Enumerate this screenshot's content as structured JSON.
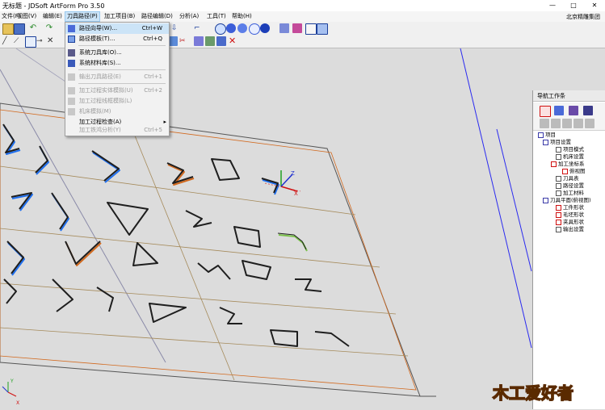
{
  "window": {
    "title": "无标题 - JDSoft ArtForm Pro 3.50",
    "controls": [
      "—",
      "□",
      "✕"
    ]
  },
  "menubar": {
    "items": [
      {
        "label": "文件(F)"
      },
      {
        "label": "视图(V)"
      },
      {
        "label": "编辑(E)"
      },
      {
        "label": "刀具路径(P)"
      },
      {
        "label": "加工项目(B)"
      },
      {
        "label": "路径编辑(D)"
      },
      {
        "label": "分析(A)"
      },
      {
        "label": "工具(T)"
      },
      {
        "label": "帮助(H)"
      }
    ],
    "company": "北京精雕集团"
  },
  "toolpath_menu": {
    "items": [
      {
        "label": "路径向导(W)...",
        "shortcut": "Ctrl+W",
        "enabled": true,
        "icon": "path-wizard-icon"
      },
      {
        "label": "路径模板(T)...",
        "shortcut": "Ctrl+Q",
        "enabled": true,
        "icon": "path-template-icon"
      },
      {
        "label": "系统刀具库(O)...",
        "shortcut": "",
        "enabled": true,
        "icon": "tool-library-icon"
      },
      {
        "label": "系统材料库(S)...",
        "shortcut": "",
        "enabled": true,
        "icon": "material-library-icon"
      },
      {
        "label": "输出刀具路径(E)",
        "shortcut": "Ctrl+1",
        "enabled": false,
        "icon": "output-path-icon"
      },
      {
        "label": "加工过程实体模拟(U)",
        "shortcut": "Ctrl+2",
        "enabled": false,
        "icon": "solid-sim-icon"
      },
      {
        "label": "加工过程线框模拟(L)",
        "shortcut": "",
        "enabled": false,
        "icon": "wireframe-sim-icon"
      },
      {
        "label": "机床模拟(M)",
        "shortcut": "",
        "enabled": false,
        "icon": "machine-sim-icon"
      },
      {
        "label": "加工过程检查(A)",
        "shortcut": "",
        "enabled": true,
        "submenu": true
      },
      {
        "label": "加工铁鸿分析(Y)",
        "shortcut": "Ctrl+5",
        "enabled": false
      }
    ]
  },
  "nav_panel": {
    "title": "导航工作条",
    "tree": [
      {
        "label": "项目",
        "level": 0
      },
      {
        "label": "项目设置",
        "level": 1
      },
      {
        "label": "项目模式",
        "level": 2
      },
      {
        "label": "机床设置",
        "level": 2
      },
      {
        "label": "加工坐标系",
        "level": 2
      },
      {
        "label": "俯视图",
        "level": 3
      },
      {
        "label": "刀具表",
        "level": 2
      },
      {
        "label": "路径设置",
        "level": 2
      },
      {
        "label": "加工材料",
        "level": 2
      },
      {
        "label": "刀具平面(俯视图)",
        "level": 1
      },
      {
        "label": "工件形状",
        "level": 2
      },
      {
        "label": "毛坯形状",
        "level": 2
      },
      {
        "label": "夹具形状",
        "level": 2
      },
      {
        "label": "输出设置",
        "level": 2
      }
    ]
  },
  "axis_labels": {
    "x": "X",
    "y": "Y",
    "z": "Z"
  },
  "watermark": {
    "text": "木工爱好者"
  },
  "colors": {
    "viewport_bg": "#dcdcdc",
    "highlight": "#cce4f7",
    "grid_line": "#a58a5a",
    "border_line": "#2a2af0",
    "stroke_dark": "#1e1e1e",
    "stroke_orange": "#d2691e",
    "stroke_blue": "#1e6ff0"
  }
}
